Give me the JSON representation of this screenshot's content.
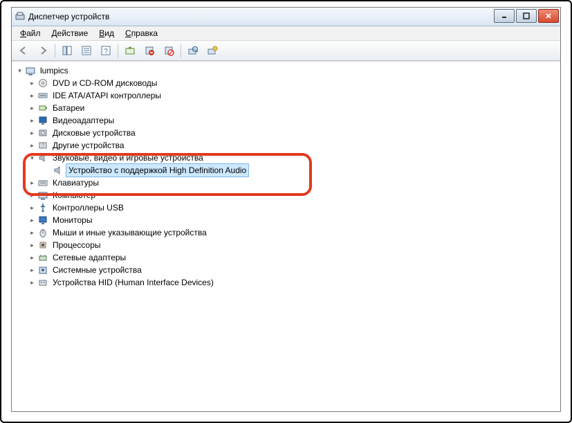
{
  "window": {
    "title": "Диспетчер устройств"
  },
  "menu": {
    "file": "Файл",
    "action": "Действие",
    "view": "Вид",
    "help": "Справка"
  },
  "tree": {
    "root": "lumpics",
    "items": [
      "DVD и CD-ROM дисководы",
      "IDE ATA/ATAPI контроллеры",
      "Батареи",
      "Видеоадаптеры",
      "Дисковые устройства",
      "Другие устройства"
    ],
    "audio_category": "Звуковые, видео и игровые устройства",
    "audio_device": "Устройство с поддержкой High Definition Audio",
    "items_after": [
      "Клавиатуры",
      "Компьютер",
      "Контроллеры USB",
      "Мониторы",
      "Мыши и иные указывающие устройства",
      "Процессоры",
      "Сетевые адаптеры",
      "Системные устройства",
      "Устройства HID (Human Interface Devices)"
    ]
  },
  "icons": {
    "root": "computer-icon",
    "cat": [
      "disc-icon",
      "ide-icon",
      "battery-icon",
      "display-icon",
      "disk-icon",
      "unknown-icon"
    ],
    "audio": "speaker-icon",
    "after": [
      "keyboard-icon",
      "computer-icon",
      "usb-icon",
      "monitor-icon",
      "mouse-icon",
      "cpu-icon",
      "network-icon",
      "system-icon",
      "hid-icon"
    ]
  }
}
